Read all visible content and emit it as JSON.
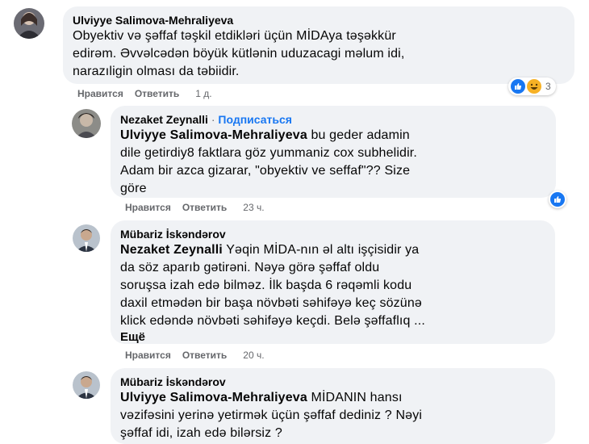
{
  "comments": [
    {
      "author": "Ulviyye Salimova-Mehraliyeva",
      "lines": [
        "Obyektiv və şəffaf təşkil etdikləri üçün MİDAya təşəkkür",
        "edirəm. Əvvəlcədən böyük kütlənin uduzacagi məlum idi,",
        "narazıligin olması da təbiidir."
      ],
      "like_label": "Нравится",
      "reply_label": "Ответить",
      "time": "1 д.",
      "reaction_count": "3"
    },
    {
      "author": "Nezaket Zeynalli",
      "separator": " · ",
      "follow_label": "Подписаться",
      "mention": "Ulviyye Salimova-Mehraliyeva",
      "lines": [
        " bu geder adamin",
        "dile getirdiy8 faktlara göz yummaniz cox subhelidir.",
        "Adam bir azca gizarar, \"obyektiv ve seffaf\"?? Size",
        "göre"
      ],
      "like_label": "Нравится",
      "reply_label": "Ответить",
      "time": "23 ч."
    },
    {
      "author": "Mübariz İskəndərov",
      "mention": "Nezaket Zeynalli",
      "lines": [
        " Yəqin MİDA-nın əl altı işçisidir ya",
        "da söz aparıb gətirəni. Nəyə görə şəffaf oldu",
        "soruşsa izah edə bilməz. İlk başda 6 rəqəmli kodu",
        "daxil etmədən bir başa növbəti səhifəyə keç sözünə",
        "klick edəndə növbəti səhifəyə keçdi. Belə şəffaflıq ..."
      ],
      "more_label": "Ещё",
      "like_label": "Нравится",
      "reply_label": "Ответить",
      "time": "20 ч."
    },
    {
      "author": "Mübariz İskəndərov",
      "mention": "Ulviyye Salimova-Mehraliyeva",
      "lines": [
        " MİDANIN hansı",
        "vəzifəsini yerinə yetirmək üçün şəffaf dediniz ? Nəyi",
        "şəffaf idi, izah edə bilərsiz ?"
      ]
    }
  ],
  "reaction_icons": [
    "like-icon",
    "haha-icon"
  ],
  "colors": {
    "accent": "#1877f2",
    "bubble": "#f0f2f5",
    "meta": "#65676b"
  }
}
